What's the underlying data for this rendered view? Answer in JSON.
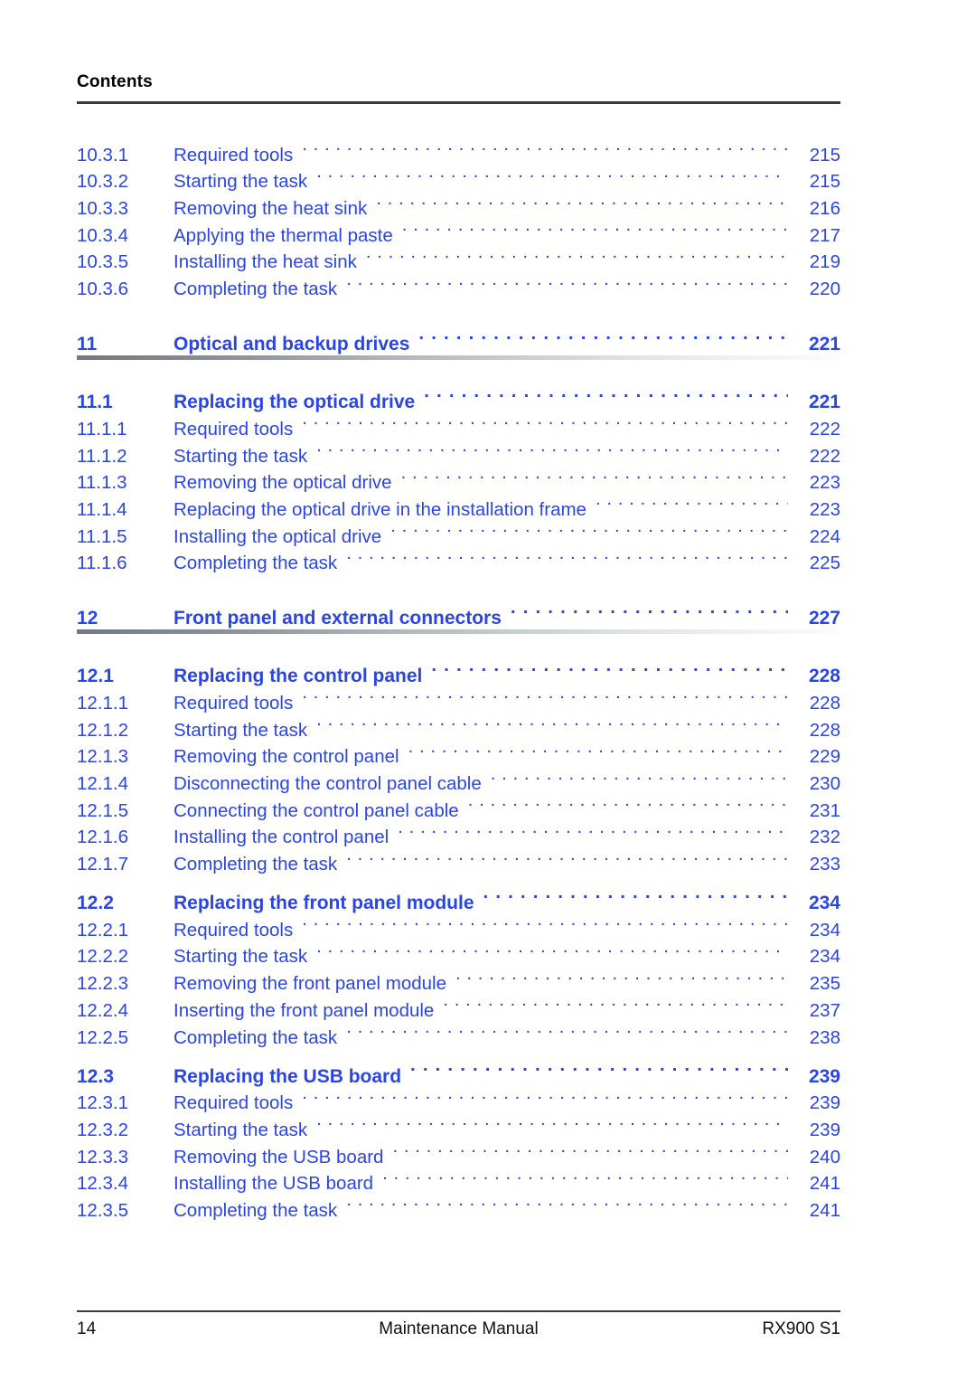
{
  "running_head": {
    "title": "Contents"
  },
  "toc": [
    {
      "level": 3,
      "number": "10.3.1",
      "title": "Required tools",
      "page": "215"
    },
    {
      "level": 3,
      "number": "10.3.2",
      "title": "Starting the task",
      "page": "215"
    },
    {
      "level": 3,
      "number": "10.3.3",
      "title": "Removing the heat sink",
      "page": "216"
    },
    {
      "level": 3,
      "number": "10.3.4",
      "title": "Applying the thermal paste",
      "page": "217"
    },
    {
      "level": 3,
      "number": "10.3.5",
      "title": "Installing the heat sink",
      "page": "219"
    },
    {
      "level": 3,
      "number": "10.3.6",
      "title": "Completing the task",
      "page": "220"
    },
    {
      "level": 1,
      "number": "11",
      "title": "Optical and backup drives",
      "page": "221",
      "rule": true
    },
    {
      "level": 2,
      "number": "11.1",
      "title": "Replacing the optical drive",
      "page": "221"
    },
    {
      "level": 3,
      "number": "11.1.1",
      "title": "Required tools",
      "page": "222"
    },
    {
      "level": 3,
      "number": "11.1.2",
      "title": "Starting the task",
      "page": "222"
    },
    {
      "level": 3,
      "number": "11.1.3",
      "title": "Removing the optical drive",
      "page": "223"
    },
    {
      "level": 3,
      "number": "11.1.4",
      "title": "Replacing the optical drive in the installation frame",
      "page": "223"
    },
    {
      "level": 3,
      "number": "11.1.5",
      "title": "Installing the optical drive",
      "page": "224"
    },
    {
      "level": 3,
      "number": "11.1.6",
      "title": "Completing the task",
      "page": "225"
    },
    {
      "level": 1,
      "number": "12",
      "title": "Front panel and external connectors",
      "page": "227",
      "rule": true
    },
    {
      "level": 2,
      "number": "12.1",
      "title": "Replacing the control panel",
      "page": "228"
    },
    {
      "level": 3,
      "number": "12.1.1",
      "title": "Required tools",
      "page": "228"
    },
    {
      "level": 3,
      "number": "12.1.2",
      "title": "Starting the task",
      "page": "228"
    },
    {
      "level": 3,
      "number": "12.1.3",
      "title": "Removing the control panel",
      "page": "229"
    },
    {
      "level": 3,
      "number": "12.1.4",
      "title": "Disconnecting the control panel cable",
      "page": "230"
    },
    {
      "level": 3,
      "number": "12.1.5",
      "title": "Connecting the control panel cable",
      "page": "231"
    },
    {
      "level": 3,
      "number": "12.1.6",
      "title": "Installing the control panel",
      "page": "232"
    },
    {
      "level": 3,
      "number": "12.1.7",
      "title": "Completing the task",
      "page": "233"
    },
    {
      "level": 2,
      "number": "12.2",
      "title": "Replacing the front panel module",
      "page": "234",
      "gap": "small"
    },
    {
      "level": 3,
      "number": "12.2.1",
      "title": "Required tools",
      "page": "234"
    },
    {
      "level": 3,
      "number": "12.2.2",
      "title": "Starting the task",
      "page": "234"
    },
    {
      "level": 3,
      "number": "12.2.3",
      "title": "Removing the front panel module",
      "page": "235"
    },
    {
      "level": 3,
      "number": "12.2.4",
      "title": "Inserting the front panel module",
      "page": "237"
    },
    {
      "level": 3,
      "number": "12.2.5",
      "title": "Completing the task",
      "page": "238"
    },
    {
      "level": 2,
      "number": "12.3",
      "title": "Replacing the USB board",
      "page": "239",
      "gap": "small"
    },
    {
      "level": 3,
      "number": "12.3.1",
      "title": "Required tools",
      "page": "239"
    },
    {
      "level": 3,
      "number": "12.3.2",
      "title": "Starting the task",
      "page": "239"
    },
    {
      "level": 3,
      "number": "12.3.3",
      "title": "Removing the USB board",
      "page": "240"
    },
    {
      "level": 3,
      "number": "12.3.4",
      "title": "Installing the USB board",
      "page": "241"
    },
    {
      "level": 3,
      "number": "12.3.5",
      "title": "Completing the task",
      "page": "241"
    }
  ],
  "footer": {
    "page_number": "14",
    "document_title": "Maintenance Manual",
    "product": "RX900 S1"
  },
  "colors": {
    "toc_text": "#2b45e3",
    "rule_dark": "#3c3c3c",
    "footer_text": "#111111"
  }
}
